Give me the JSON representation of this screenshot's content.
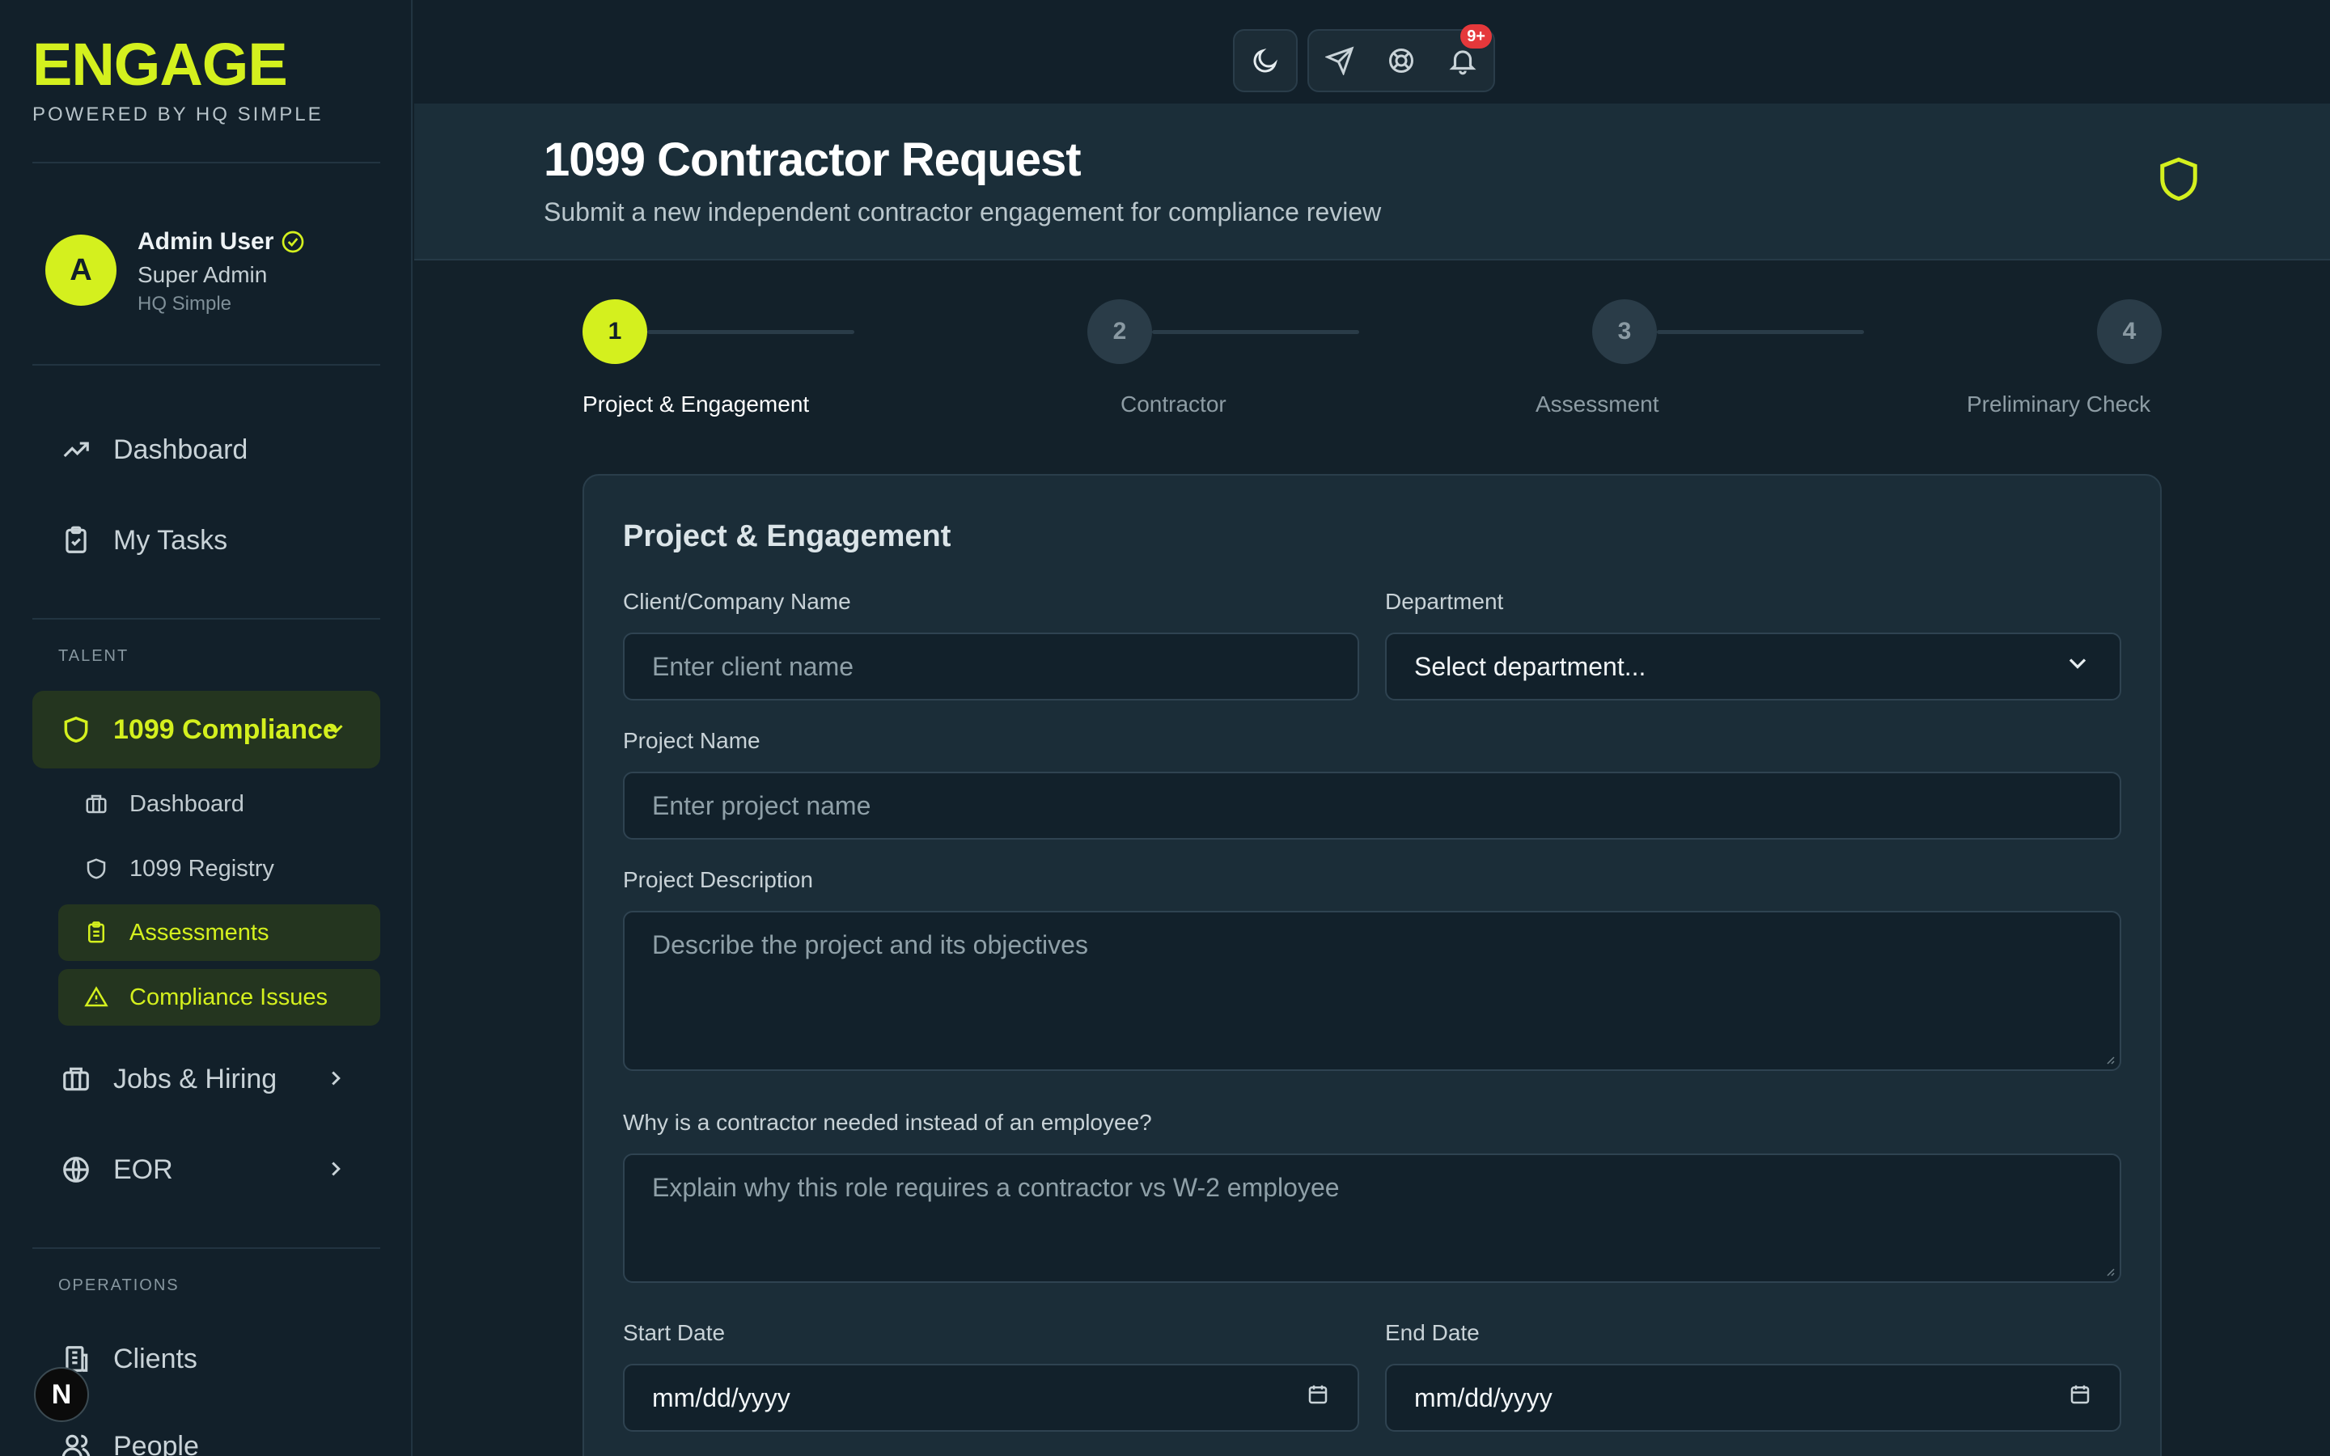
{
  "brand": {
    "title": "ENGAGE",
    "subtitle": "POWERED BY HQ SIMPLE"
  },
  "user": {
    "initial": "A",
    "name": "Admin User",
    "role": "Super Admin",
    "org": "HQ Simple"
  },
  "nav": {
    "dashboard": "Dashboard",
    "my_tasks": "My Tasks",
    "section_talent": "TALENT",
    "compliance": "1099 Compliance",
    "sub": [
      "Dashboard",
      "1099 Registry",
      "Assessments",
      "Compliance Issues"
    ],
    "jobs": "Jobs & Hiring",
    "eor": "EOR",
    "section_operations": "OPERATIONS",
    "clients": "Clients",
    "people": "People"
  },
  "topbar": {
    "notif_count": "9+"
  },
  "header": {
    "title": "1099 Contractor Request",
    "subtitle": "Submit a new independent contractor engagement for compliance review"
  },
  "stepper": {
    "steps": [
      {
        "num": "1",
        "label": "Project & Engagement"
      },
      {
        "num": "2",
        "label": "Contractor"
      },
      {
        "num": "3",
        "label": "Assessment"
      },
      {
        "num": "4",
        "label": "Preliminary Check"
      }
    ]
  },
  "form": {
    "section_title": "Project & Engagement",
    "client_label": "Client/Company Name",
    "client_placeholder": "Enter client name",
    "department_label": "Department",
    "department_value": "Select department...",
    "project_label": "Project Name",
    "project_placeholder": "Enter project name",
    "description_label": "Project Description",
    "description_placeholder": "Describe the project and its objectives",
    "why_label": "Why is a contractor needed instead of an employee?",
    "why_placeholder": "Explain why this role requires a contractor vs W-2 employee",
    "start_label": "Start Date",
    "start_value": "mm/dd/yyyy",
    "end_label": "End Date",
    "end_value": "mm/dd/yyyy"
  },
  "colors": {
    "accent": "#d4f01e",
    "background": "#13212a",
    "card": "#1b2d38",
    "badge": "#e5383b"
  },
  "icons": [
    "trending-up-icon",
    "clipboard-check-icon",
    "shield-icon",
    "chevron-down-icon",
    "briefcase-icon",
    "clipboard-list-icon",
    "alert-triangle-icon",
    "chevron-right-icon",
    "globe-icon",
    "building-icon",
    "users-icon",
    "moon-icon",
    "send-icon",
    "lifebuoy-icon",
    "bell-icon",
    "calendar-icon",
    "verified-icon"
  ]
}
